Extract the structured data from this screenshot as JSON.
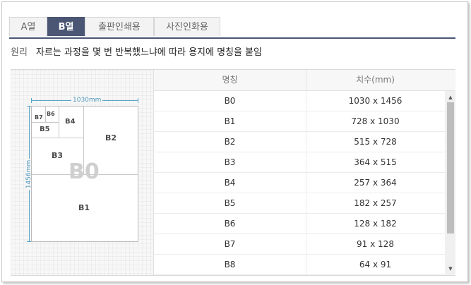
{
  "tabs": [
    {
      "label": "A열",
      "active": false
    },
    {
      "label": "B열",
      "active": true
    },
    {
      "label": "출판인쇄용",
      "active": false
    },
    {
      "label": "사진인화용",
      "active": false
    }
  ],
  "principle": {
    "label": "원리",
    "text": "자르는 과정을 몇 번 반복했느냐에 따라 용지에 명칭을 붙임"
  },
  "diagram": {
    "width_label": "1030mm",
    "height_label": "1456mm",
    "watermark": "B0",
    "labels": {
      "B1": "B1",
      "B2": "B2",
      "B3": "B3",
      "B4": "B4",
      "B5": "B5",
      "B6": "B6",
      "B7": "B7"
    }
  },
  "table": {
    "headers": [
      "명칭",
      "치수(mm)"
    ],
    "rows": [
      {
        "name": "B0",
        "size": "1030 x 1456"
      },
      {
        "name": "B1",
        "size": "728 x 1030"
      },
      {
        "name": "B2",
        "size": "515 x 728"
      },
      {
        "name": "B3",
        "size": "364 x 515"
      },
      {
        "name": "B4",
        "size": "257 x 364"
      },
      {
        "name": "B5",
        "size": "182 x 257"
      },
      {
        "name": "B6",
        "size": "128 x 182"
      },
      {
        "name": "B7",
        "size": "91 x 128"
      },
      {
        "name": "B8",
        "size": "64 x 91"
      }
    ]
  },
  "colors": {
    "accent": "#4a5673",
    "dimension": "#5aa6c9"
  },
  "icons": {
    "scroll_up": "scroll-up-arrow-icon",
    "scroll_down": "scroll-down-arrow-icon"
  }
}
